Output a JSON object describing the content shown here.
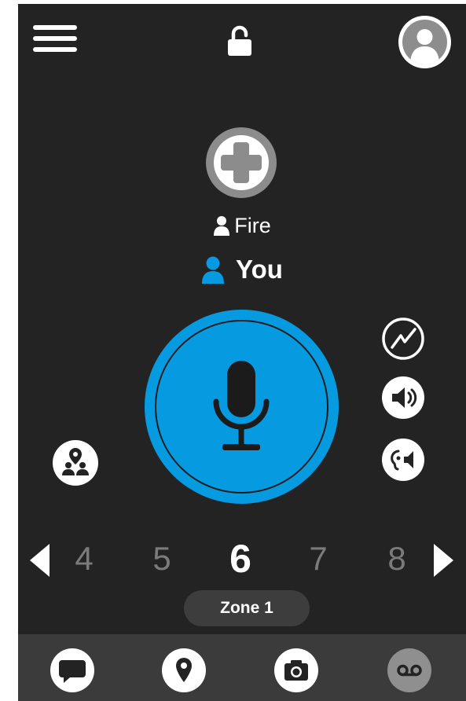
{
  "channel": {
    "talkgroup_name": "Fire",
    "current_user": "You"
  },
  "selector": {
    "channels": [
      "4",
      "5",
      "6",
      "7",
      "8"
    ],
    "active_channel": "6"
  },
  "zone": {
    "label": "Zone 1"
  },
  "icons": {
    "menu": "hamburger-menu-icon",
    "lock": "unlocked-padlock-icon",
    "profile": "user-avatar-icon",
    "channel": "medical-cross-icon",
    "ptt": "microphone-icon",
    "graph": "signal-graph-icon",
    "speaker": "speaker-icon",
    "earpiece": "earpiece-icon",
    "group": "group-location-icon",
    "messages": "chat-bubble-icon",
    "location": "map-pin-icon",
    "camera": "camera-icon",
    "voicemail": "voicemail-icon"
  },
  "colors": {
    "background": "#232323",
    "accent_blue": "#069ae0",
    "bottom_bar": "#3b3b3b",
    "inactive_channel": "#7b7b7b",
    "disabled_button": "#8f8f8f"
  }
}
